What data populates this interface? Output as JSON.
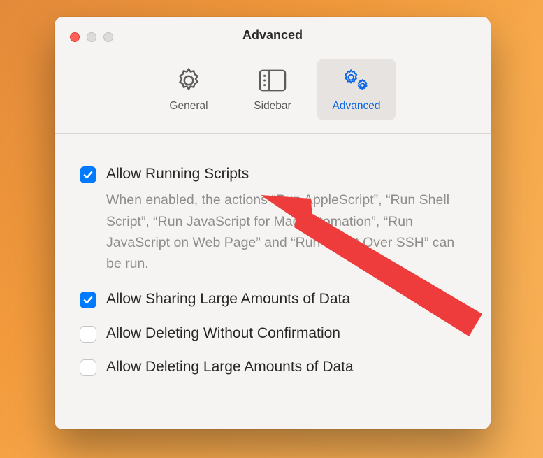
{
  "window": {
    "title": "Advanced"
  },
  "tabs": {
    "general": "General",
    "sidebar": "Sidebar",
    "advanced": "Advanced"
  },
  "options": {
    "scripts": {
      "label": "Allow Running Scripts",
      "desc": "When enabled, the actions “Run AppleScript”, “Run Shell Script”, “Run JavaScript for Mac Automation”, “Run JavaScript on Web Page” and “Run Script Over SSH” can be run."
    },
    "share_large": {
      "label": "Allow Sharing Large Amounts of Data"
    },
    "delete_noconfirm": {
      "label": "Allow Deleting Without Confirmation"
    },
    "delete_large": {
      "label": "Allow Deleting Large Amounts of Data"
    }
  }
}
